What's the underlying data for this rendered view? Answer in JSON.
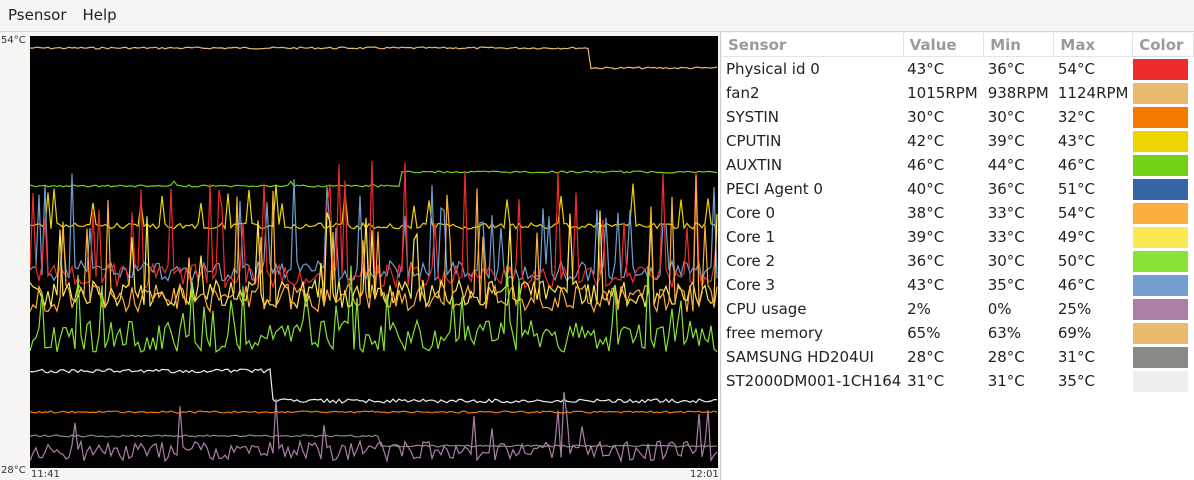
{
  "menu": {
    "items": [
      "Psensor",
      "Help"
    ]
  },
  "graph": {
    "y_max_label": "54°C",
    "y_min_label": "28°C",
    "x_start_label": "11:41",
    "x_end_label": "12:01",
    "background": "#000000"
  },
  "table": {
    "headers": {
      "sensor": "Sensor",
      "value": "Value",
      "min": "Min",
      "max": "Max",
      "color": "Color"
    },
    "rows": [
      {
        "sensor": "Physical id 0",
        "value": "43°C",
        "min": "36°C",
        "max": "54°C",
        "color": "#ee2c2c"
      },
      {
        "sensor": "fan2",
        "value": "1015RPM",
        "min": "938RPM",
        "max": "1124RPM",
        "color": "#e8b96f"
      },
      {
        "sensor": "SYSTIN",
        "value": "30°C",
        "min": "30°C",
        "max": "32°C",
        "color": "#f57900"
      },
      {
        "sensor": "CPUTIN",
        "value": "42°C",
        "min": "39°C",
        "max": "43°C",
        "color": "#edd400"
      },
      {
        "sensor": "AUXTIN",
        "value": "46°C",
        "min": "44°C",
        "max": "46°C",
        "color": "#73d216"
      },
      {
        "sensor": "PECI Agent 0",
        "value": "40°C",
        "min": "36°C",
        "max": "51°C",
        "color": "#3465a4"
      },
      {
        "sensor": "Core 0",
        "value": "38°C",
        "min": "33°C",
        "max": "54°C",
        "color": "#fcaf3e"
      },
      {
        "sensor": "Core 1",
        "value": "39°C",
        "min": "33°C",
        "max": "49°C",
        "color": "#fce94f"
      },
      {
        "sensor": "Core 2",
        "value": "36°C",
        "min": "30°C",
        "max": "50°C",
        "color": "#8ae234"
      },
      {
        "sensor": "Core 3",
        "value": "43°C",
        "min": "35°C",
        "max": "46°C",
        "color": "#729fcf"
      },
      {
        "sensor": "CPU usage",
        "value": "2%",
        "min": "0%",
        "max": "25%",
        "color": "#ad7fa8"
      },
      {
        "sensor": "free memory",
        "value": "65%",
        "min": "63%",
        "max": "69%",
        "color": "#e9b96e"
      },
      {
        "sensor": "SAMSUNG HD204UI",
        "value": "28°C",
        "min": "28°C",
        "max": "31°C",
        "color": "#888a85"
      },
      {
        "sensor": "ST2000DM001-1CH164",
        "value": "31°C",
        "min": "31°C",
        "max": "35°C",
        "color": "#eeeeec"
      }
    ]
  }
}
